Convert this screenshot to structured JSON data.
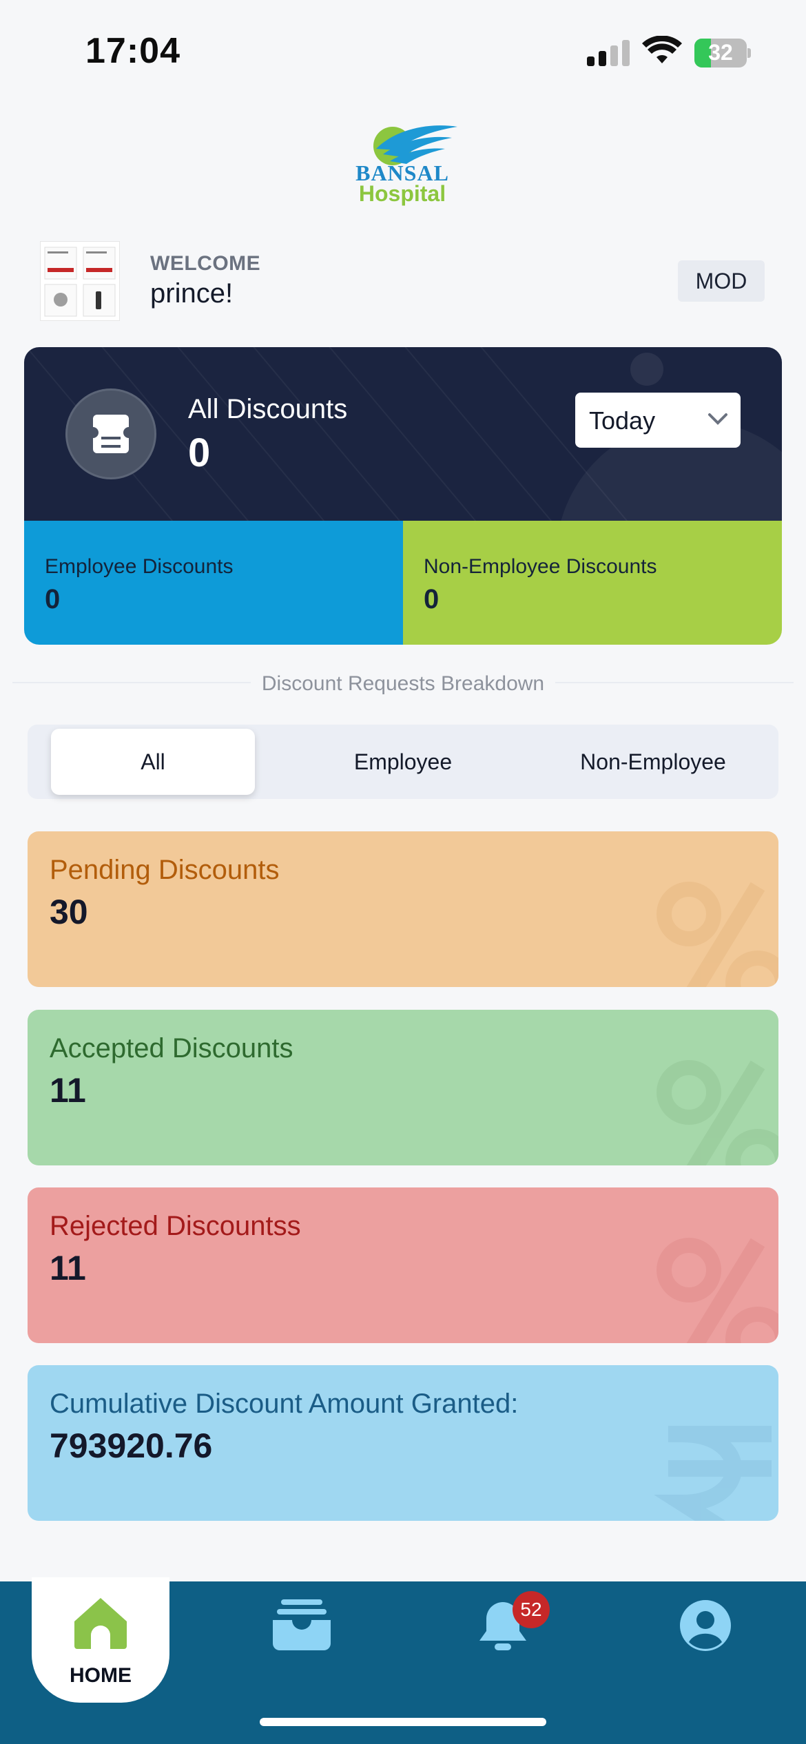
{
  "status_bar": {
    "time": "17:04",
    "battery": "32"
  },
  "header": {
    "logo_line1": "BANSAL",
    "logo_line2": "Hospital"
  },
  "welcome": {
    "label": "WELCOME",
    "name": "prince!",
    "role": "MOD"
  },
  "summary": {
    "title": "All Discounts",
    "value": "0",
    "period": "Today",
    "employee_label": "Employee Discounts",
    "employee_value": "0",
    "non_employee_label": "Non-Employee Discounts",
    "non_employee_value": "0"
  },
  "breakdown": {
    "title": "Discount Requests Breakdown",
    "tabs": [
      {
        "label": "All",
        "active": true
      },
      {
        "label": "Employee",
        "active": false
      },
      {
        "label": "Non-Employee",
        "active": false
      }
    ]
  },
  "cards": [
    {
      "label": "Pending Discounts",
      "value": "30",
      "bg": "#f2c998",
      "fg": "#b25d0b",
      "deco": "percent-icon"
    },
    {
      "label": "Accepted Discounts",
      "value": "11",
      "bg": "#a6d8aa",
      "fg": "#2e6a2f",
      "deco": "percent-icon"
    },
    {
      "label": "Rejected Discountss",
      "value": "11",
      "bg": "#eca09f",
      "fg": "#a31a1a",
      "deco": "percent-icon"
    },
    {
      "label": "Cumulative Discount Amount Granted:",
      "value": "793920.76",
      "bg": "#9fd7f1",
      "fg": "#1a5c86",
      "deco": "rupee-icon"
    }
  ],
  "nav": {
    "home_label": "HOME",
    "items": [
      "home-icon",
      "inbox-icon",
      "bell-icon",
      "profile-icon"
    ],
    "notification_count": "52"
  },
  "colors": {
    "summary_bg": "#1b2440",
    "employee": "#0e9bd8",
    "non_employee": "#a7cf46",
    "nav_bg": "#0e5f85",
    "home_icon": "#8bc34a"
  }
}
